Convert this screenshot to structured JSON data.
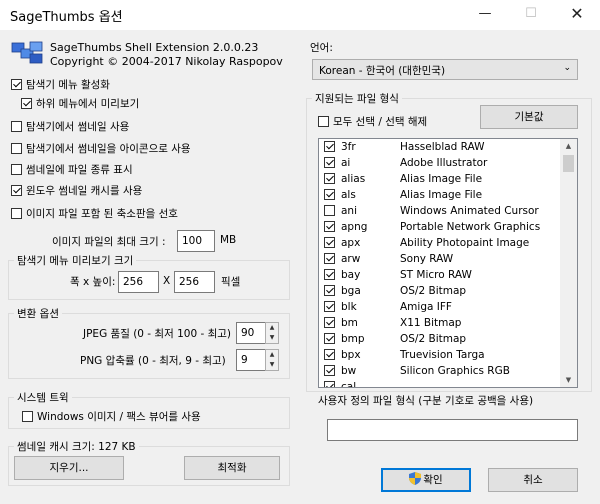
{
  "window": {
    "title": "SageThumbs 옵션"
  },
  "app": {
    "name": "SageThumbs Shell Extension 2.0.0.23",
    "copyright": "Copyright © 2004-2017 Nikolay Raspopov"
  },
  "options": {
    "enable_explorer_menu": {
      "label": "탐색기 메뉴 활성화",
      "checked": true
    },
    "submenu_preview": {
      "label": "하위 메뉴에서 미리보기",
      "checked": true
    },
    "explorer_thumbnails": {
      "label": "탐색기에서 썸네일 사용",
      "checked": false
    },
    "thumbnails_as_icons": {
      "label": "탐색기에서 썸네일을 아이콘으로 사용",
      "checked": false
    },
    "show_filetype_on_thumb": {
      "label": "썸네일에 파일 종류 표시",
      "checked": false
    },
    "windows_thumb_cache": {
      "label": "윈도우 썸네일 캐시를 사용",
      "checked": true
    },
    "prefer_embedded": {
      "label": "이미지 파일 포함 된 축소판을 선호",
      "checked": false
    }
  },
  "max_size": {
    "label": "이미지 파일의 최대 크기 :",
    "value": "100",
    "unit": "MB"
  },
  "preview_size": {
    "legend": "탐색기 메뉴 미리보기 크기",
    "label": "폭 x 높이:",
    "width": "256",
    "sep": "X",
    "height": "256",
    "unit": "픽셀"
  },
  "conversion": {
    "legend": "변환 옵션",
    "jpeg_label": "JPEG 품질 (0 - 최저 100 - 최고)",
    "jpeg_value": "90",
    "png_label": "PNG 압축률 (0 - 최저, 9 - 최고)",
    "png_value": "9"
  },
  "system_tray": {
    "legend": "시스템 트윅",
    "windows_viewer": {
      "label": "Windows 이미지 / 팩스 뷰어를 사용",
      "checked": false
    }
  },
  "cache": {
    "label": "썸네일 캐시 크기: 127 KB",
    "clear_button": "지우기...",
    "optimize_button": "최적화"
  },
  "language": {
    "label": "언어:",
    "value": "Korean - 한국어 (대한민국)"
  },
  "filetypes": {
    "label": "지원되는 파일 형식",
    "select_all": {
      "label": "모두 선택 / 선택 해제",
      "checked": false
    },
    "default_button": "기본값",
    "items": [
      {
        "ext": "3fr",
        "desc": "Hasselblad RAW",
        "checked": true
      },
      {
        "ext": "ai",
        "desc": "Adobe Illustrator",
        "checked": true
      },
      {
        "ext": "alias",
        "desc": "Alias Image File",
        "checked": true
      },
      {
        "ext": "als",
        "desc": "Alias Image File",
        "checked": true
      },
      {
        "ext": "ani",
        "desc": "Windows Animated Cursor",
        "checked": false
      },
      {
        "ext": "apng",
        "desc": "Portable Network Graphics",
        "checked": true
      },
      {
        "ext": "apx",
        "desc": "Ability Photopaint Image",
        "checked": true
      },
      {
        "ext": "arw",
        "desc": "Sony RAW",
        "checked": true
      },
      {
        "ext": "bay",
        "desc": "ST Micro RAW",
        "checked": true
      },
      {
        "ext": "bga",
        "desc": "OS/2 Bitmap",
        "checked": true
      },
      {
        "ext": "blk",
        "desc": "Amiga IFF",
        "checked": true
      },
      {
        "ext": "bm",
        "desc": "X11 Bitmap",
        "checked": true
      },
      {
        "ext": "bmp",
        "desc": "OS/2 Bitmap",
        "checked": true
      },
      {
        "ext": "bpx",
        "desc": "Truevision Targa",
        "checked": true
      },
      {
        "ext": "bw",
        "desc": "Silicon Graphics RGB",
        "checked": true
      },
      {
        "ext": "cal",
        "desc": "",
        "checked": true
      }
    ]
  },
  "custom_types": {
    "label": "사용자 정의 파일 형식 (구분 기호로 공백을 사용)",
    "value": ""
  },
  "buttons": {
    "ok": "확인",
    "cancel": "취소"
  }
}
